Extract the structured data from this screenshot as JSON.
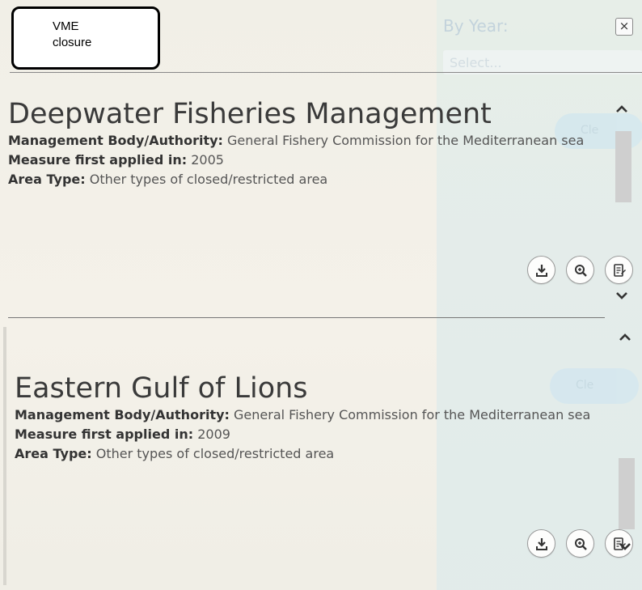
{
  "overlay": {
    "label_line1": "VME",
    "label_line2": "closure"
  },
  "background": {
    "by_year_label": "By Year:",
    "select_placeholder": "Select...",
    "clear_label_1": "Cle",
    "clear_label_2": "Cle"
  },
  "popup": {
    "close_symbol": "×",
    "results": [
      {
        "title": "Deepwater Fisheries Management",
        "authority_label": "Management Body/Authority:",
        "authority_value": "General Fishery Commission for the Mediterranean sea",
        "year_label": "Measure first applied in:",
        "year_value": "2005",
        "area_label": "Area Type:",
        "area_value": "Other types of closed/restricted area"
      },
      {
        "title": "Eastern Gulf of Lions",
        "authority_label": "Management Body/Authority:",
        "authority_value": "General Fishery Commission for the Mediterranean sea",
        "year_label": "Measure first applied in:",
        "year_value": "2009",
        "area_label": "Area Type:",
        "area_value": "Other types of closed/restricted area"
      }
    ]
  },
  "icons": [
    "download-icon",
    "zoom-in-icon",
    "factsheet-icon",
    "chevron-up-icon",
    "chevron-down-icon",
    "close-icon"
  ]
}
